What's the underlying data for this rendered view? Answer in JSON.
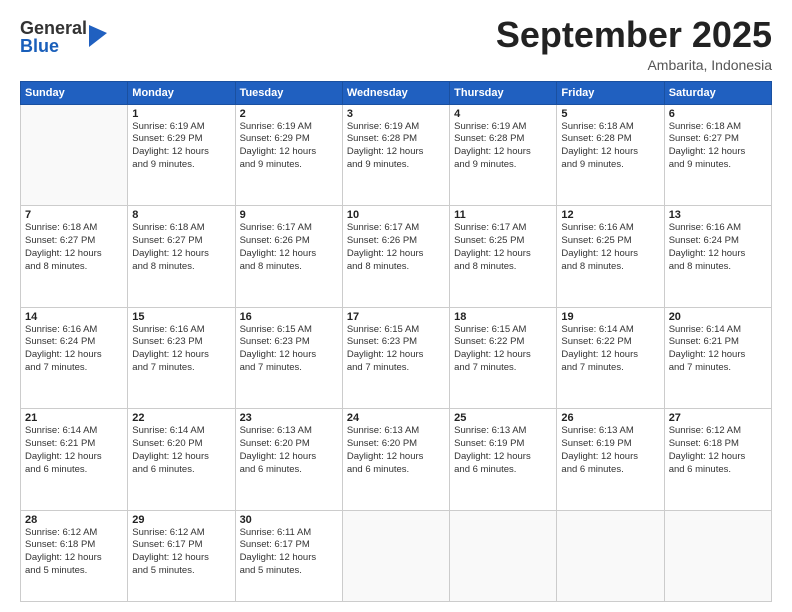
{
  "header": {
    "logo_general": "General",
    "logo_blue": "Blue",
    "month_title": "September 2025",
    "location": "Ambarita, Indonesia"
  },
  "days_of_week": [
    "Sunday",
    "Monday",
    "Tuesday",
    "Wednesday",
    "Thursday",
    "Friday",
    "Saturday"
  ],
  "weeks": [
    [
      {
        "day": "",
        "info": ""
      },
      {
        "day": "1",
        "info": "Sunrise: 6:19 AM\nSunset: 6:29 PM\nDaylight: 12 hours\nand 9 minutes."
      },
      {
        "day": "2",
        "info": "Sunrise: 6:19 AM\nSunset: 6:29 PM\nDaylight: 12 hours\nand 9 minutes."
      },
      {
        "day": "3",
        "info": "Sunrise: 6:19 AM\nSunset: 6:28 PM\nDaylight: 12 hours\nand 9 minutes."
      },
      {
        "day": "4",
        "info": "Sunrise: 6:19 AM\nSunset: 6:28 PM\nDaylight: 12 hours\nand 9 minutes."
      },
      {
        "day": "5",
        "info": "Sunrise: 6:18 AM\nSunset: 6:28 PM\nDaylight: 12 hours\nand 9 minutes."
      },
      {
        "day": "6",
        "info": "Sunrise: 6:18 AM\nSunset: 6:27 PM\nDaylight: 12 hours\nand 9 minutes."
      }
    ],
    [
      {
        "day": "7",
        "info": "Sunrise: 6:18 AM\nSunset: 6:27 PM\nDaylight: 12 hours\nand 8 minutes."
      },
      {
        "day": "8",
        "info": "Sunrise: 6:18 AM\nSunset: 6:27 PM\nDaylight: 12 hours\nand 8 minutes."
      },
      {
        "day": "9",
        "info": "Sunrise: 6:17 AM\nSunset: 6:26 PM\nDaylight: 12 hours\nand 8 minutes."
      },
      {
        "day": "10",
        "info": "Sunrise: 6:17 AM\nSunset: 6:26 PM\nDaylight: 12 hours\nand 8 minutes."
      },
      {
        "day": "11",
        "info": "Sunrise: 6:17 AM\nSunset: 6:25 PM\nDaylight: 12 hours\nand 8 minutes."
      },
      {
        "day": "12",
        "info": "Sunrise: 6:16 AM\nSunset: 6:25 PM\nDaylight: 12 hours\nand 8 minutes."
      },
      {
        "day": "13",
        "info": "Sunrise: 6:16 AM\nSunset: 6:24 PM\nDaylight: 12 hours\nand 8 minutes."
      }
    ],
    [
      {
        "day": "14",
        "info": "Sunrise: 6:16 AM\nSunset: 6:24 PM\nDaylight: 12 hours\nand 7 minutes."
      },
      {
        "day": "15",
        "info": "Sunrise: 6:16 AM\nSunset: 6:23 PM\nDaylight: 12 hours\nand 7 minutes."
      },
      {
        "day": "16",
        "info": "Sunrise: 6:15 AM\nSunset: 6:23 PM\nDaylight: 12 hours\nand 7 minutes."
      },
      {
        "day": "17",
        "info": "Sunrise: 6:15 AM\nSunset: 6:23 PM\nDaylight: 12 hours\nand 7 minutes."
      },
      {
        "day": "18",
        "info": "Sunrise: 6:15 AM\nSunset: 6:22 PM\nDaylight: 12 hours\nand 7 minutes."
      },
      {
        "day": "19",
        "info": "Sunrise: 6:14 AM\nSunset: 6:22 PM\nDaylight: 12 hours\nand 7 minutes."
      },
      {
        "day": "20",
        "info": "Sunrise: 6:14 AM\nSunset: 6:21 PM\nDaylight: 12 hours\nand 7 minutes."
      }
    ],
    [
      {
        "day": "21",
        "info": "Sunrise: 6:14 AM\nSunset: 6:21 PM\nDaylight: 12 hours\nand 6 minutes."
      },
      {
        "day": "22",
        "info": "Sunrise: 6:14 AM\nSunset: 6:20 PM\nDaylight: 12 hours\nand 6 minutes."
      },
      {
        "day": "23",
        "info": "Sunrise: 6:13 AM\nSunset: 6:20 PM\nDaylight: 12 hours\nand 6 minutes."
      },
      {
        "day": "24",
        "info": "Sunrise: 6:13 AM\nSunset: 6:20 PM\nDaylight: 12 hours\nand 6 minutes."
      },
      {
        "day": "25",
        "info": "Sunrise: 6:13 AM\nSunset: 6:19 PM\nDaylight: 12 hours\nand 6 minutes."
      },
      {
        "day": "26",
        "info": "Sunrise: 6:13 AM\nSunset: 6:19 PM\nDaylight: 12 hours\nand 6 minutes."
      },
      {
        "day": "27",
        "info": "Sunrise: 6:12 AM\nSunset: 6:18 PM\nDaylight: 12 hours\nand 6 minutes."
      }
    ],
    [
      {
        "day": "28",
        "info": "Sunrise: 6:12 AM\nSunset: 6:18 PM\nDaylight: 12 hours\nand 5 minutes."
      },
      {
        "day": "29",
        "info": "Sunrise: 6:12 AM\nSunset: 6:17 PM\nDaylight: 12 hours\nand 5 minutes."
      },
      {
        "day": "30",
        "info": "Sunrise: 6:11 AM\nSunset: 6:17 PM\nDaylight: 12 hours\nand 5 minutes."
      },
      {
        "day": "",
        "info": ""
      },
      {
        "day": "",
        "info": ""
      },
      {
        "day": "",
        "info": ""
      },
      {
        "day": "",
        "info": ""
      }
    ]
  ]
}
